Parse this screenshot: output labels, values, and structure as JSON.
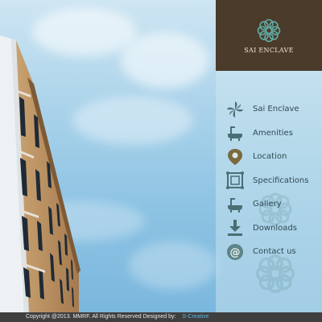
{
  "brand": {
    "name": "Sai Enclave",
    "logo_text": "SAI ENCLAVE",
    "logo_color": "#5fa8a0",
    "panel_color": "#4a3b2a"
  },
  "nav": {
    "items": [
      {
        "label": "Sai Enclave",
        "icon": "pinwheel-icon"
      },
      {
        "label": "Amenities",
        "icon": "bathtub-icon"
      },
      {
        "label": "Location",
        "icon": "map-pin-icon"
      },
      {
        "label": "Specifications",
        "icon": "frame-icon"
      },
      {
        "label": "Gallery",
        "icon": "bathtub-icon"
      },
      {
        "label": "Downloads",
        "icon": "download-icon"
      },
      {
        "label": "Contact us",
        "icon": "at-sign-icon"
      }
    ],
    "label_color": "#2f4a52",
    "icon_color": "#4a6e74"
  },
  "footer": {
    "copyright": "Copyright @2013. MMRF. All Rights Reserved Designed by:",
    "designer": "S-Creative",
    "designer_color": "#5fb6d8"
  }
}
